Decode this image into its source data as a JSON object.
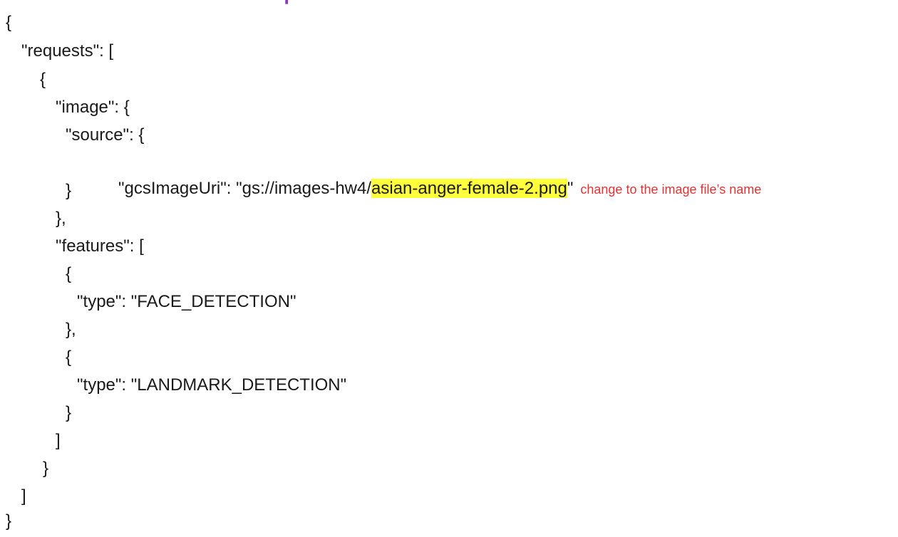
{
  "heading": {
    "text": "",
    "cursor": "|"
  },
  "code": {
    "lines": [
      "{",
      "\"requests\": [",
      "{",
      "\"image\": {",
      "\"source\": {",
      "",
      "}",
      "},",
      "\"features\": [",
      "{",
      "\"type\": \"FACE_DETECTION\"",
      "},",
      "{",
      "\"type\": \"LANDMARK_DETECTION\"",
      "}",
      "]",
      "}",
      "]",
      "}"
    ],
    "uri_line": {
      "prefix": "\"gcsImageUri\": \"gs://images-hw4/",
      "highlighted_filename": "asian-anger-female-2.png",
      "suffix": "\""
    }
  },
  "annotation": {
    "text": "change to the image file’s name",
    "color": "#e03434"
  },
  "colors": {
    "highlight": "#ffff3b",
    "text": "#1a1a1a",
    "cursor": "#8a3ab9"
  }
}
